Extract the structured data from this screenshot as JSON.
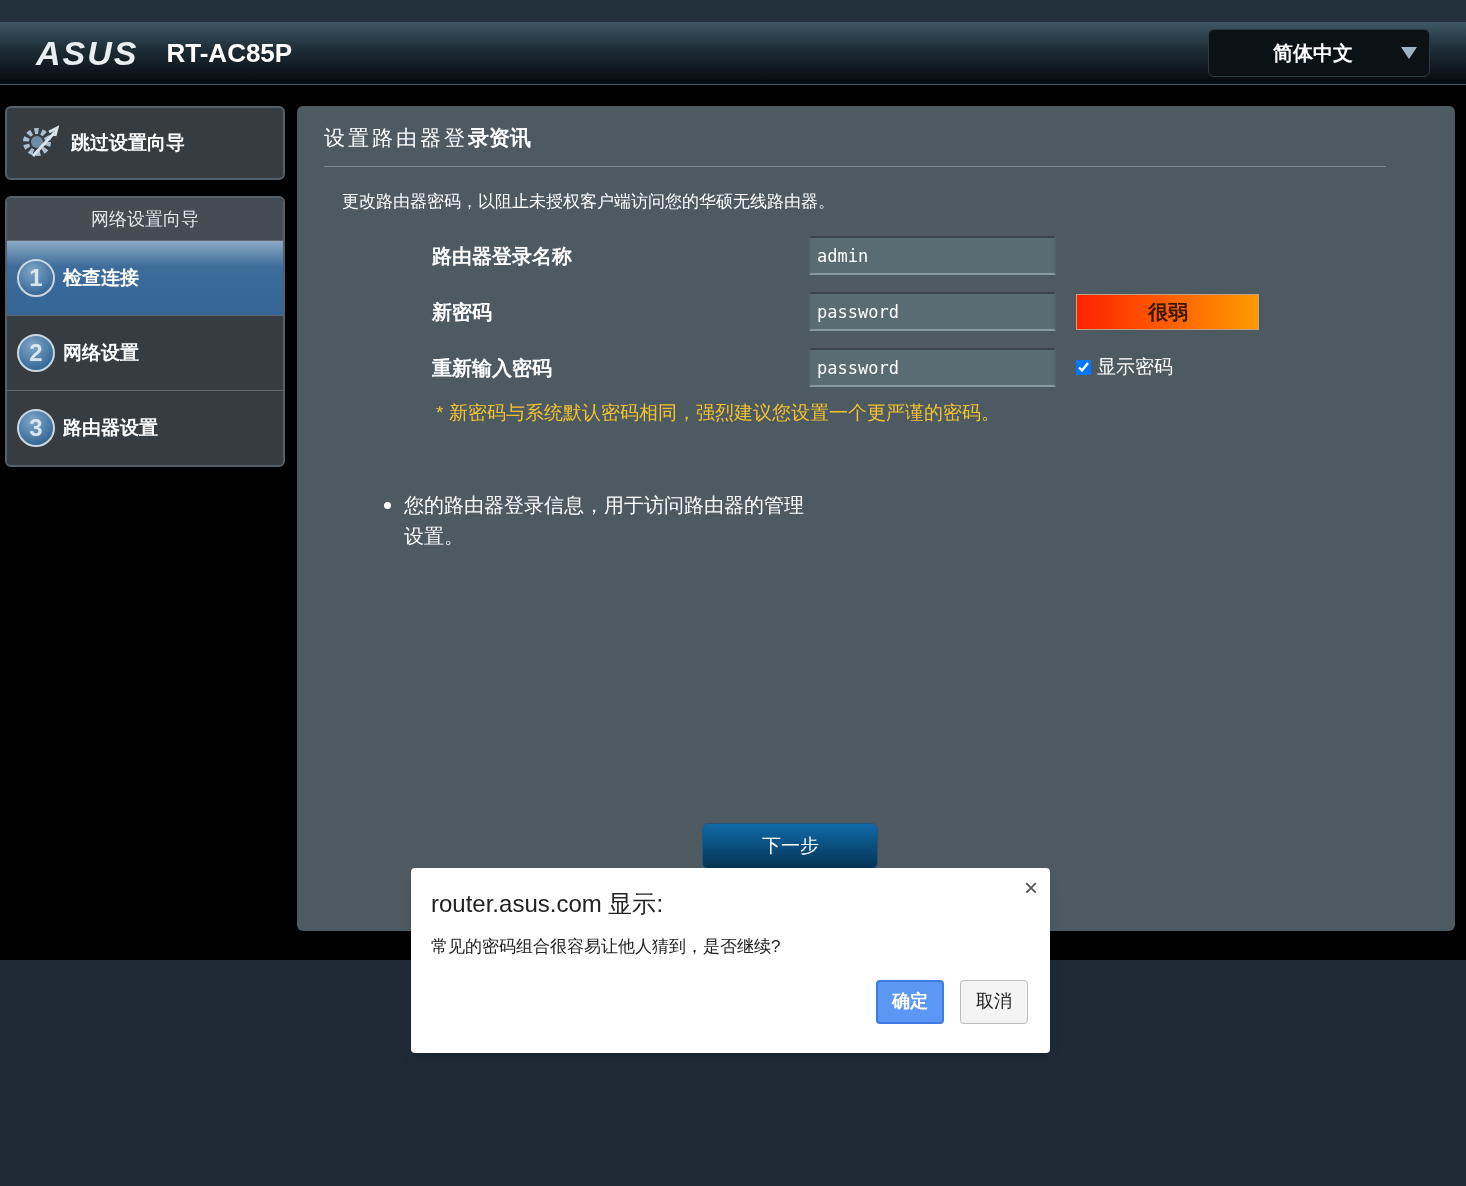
{
  "header": {
    "brand": "ASUS",
    "model": "RT-AC85P",
    "language": "简体中文"
  },
  "sidebar": {
    "skip_button": "跳过设置向导",
    "wizard_title": "网络设置向导",
    "steps": [
      {
        "number": "1",
        "label": "检查连接",
        "selected": true
      },
      {
        "number": "2",
        "label": "网络设置",
        "selected": false
      },
      {
        "number": "3",
        "label": "路由器设置",
        "selected": false
      }
    ]
  },
  "panel": {
    "title_light": "设置路由器登",
    "title_bold": "录资讯",
    "description": "更改路由器密码，以阻止未授权客户端访问您的华硕无线路由器。",
    "fields": [
      {
        "label": "路由器登录名称",
        "value": "admin"
      },
      {
        "label": "新密码",
        "value": "password"
      },
      {
        "label": "重新输入密码",
        "value": "password"
      }
    ],
    "strength": "很弱",
    "show_password": {
      "label": "显示密码",
      "checked": true
    },
    "warning": "* 新密码与系统默认密码相同，强烈建议您设置一个更严谨的密码。",
    "note": "您的路由器登录信息，用于访问路由器的管理设置。",
    "next_button": "下一步"
  },
  "dialog": {
    "title": "router.asus.com 显示:",
    "message": "常见的密码组合很容易让他人猜到，是否继续?",
    "close": "×",
    "ok_button": "确定",
    "cancel_button": "取消"
  }
}
